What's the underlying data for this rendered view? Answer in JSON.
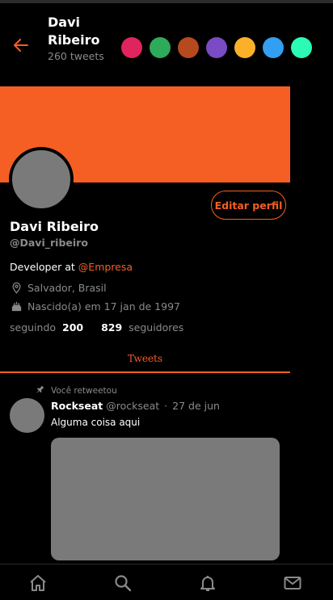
{
  "header": {
    "name": "Davi Ribeiro",
    "tweet_count": "260 tweets",
    "back_icon": "arrow-left-icon"
  },
  "theme_swatches": [
    {
      "name": "pink",
      "color": "#e0245e"
    },
    {
      "name": "green",
      "color": "#2daa5a"
    },
    {
      "name": "rust",
      "color": "#b7491e"
    },
    {
      "name": "purple",
      "color": "#794bc4"
    },
    {
      "name": "yellow",
      "color": "#fcb02a"
    },
    {
      "name": "blue",
      "color": "#329ff2"
    },
    {
      "name": "mint",
      "color": "#2cfbb4"
    }
  ],
  "accent_color": "#f55f24",
  "profile": {
    "edit_label": "Editar perfil",
    "name": "Davi Ribeiro",
    "handle": "@Davi_ribeiro",
    "bio_prefix": "Developer at ",
    "bio_link": "@Empresa",
    "location": "Salvador, Brasil",
    "birth": "Nascido(a) em 17 jan de 1997",
    "following_label": "seguindo",
    "following_count": "200",
    "followers_count": "829",
    "followers_label": "seguidores"
  },
  "tabs": [
    {
      "label": "Tweets",
      "active": true
    }
  ],
  "tweet": {
    "retweet_note": "Você retweetou",
    "author": "Rockseat",
    "handle": "@rockseat",
    "separator": "·",
    "date": "27 de jun",
    "text": "Alguma coisa aqui"
  },
  "bottom_nav": [
    {
      "icon": "home-icon"
    },
    {
      "icon": "search-icon"
    },
    {
      "icon": "bell-icon"
    },
    {
      "icon": "mail-icon"
    }
  ]
}
